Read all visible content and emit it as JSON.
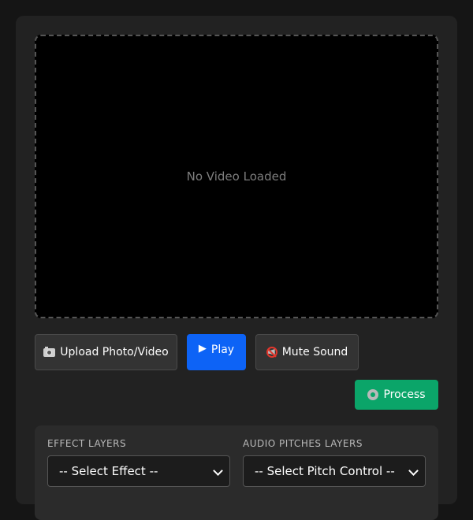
{
  "preview": {
    "placeholder": "No Video Loaded"
  },
  "controls": {
    "upload_label": "Upload Photo/Video",
    "play_label": "Play",
    "mute_label": "Mute Sound",
    "process_label": "Process"
  },
  "layers": {
    "effect_title": "EFFECT LAYERS",
    "effect_select": "-- Select Effect --",
    "pitch_title": "AUDIO PITCHES LAYERS",
    "pitch_select": "-- Select Pitch Control --"
  },
  "icons": {
    "upload": "camera-icon",
    "play": "play-icon",
    "mute": "mute-icon",
    "process": "gear-icon",
    "select": "chevron-down-icon"
  },
  "colors": {
    "play_button": "#0d63f6",
    "process_button": "#0ba569",
    "panel_background": "#222222",
    "page_background": "#151515"
  }
}
